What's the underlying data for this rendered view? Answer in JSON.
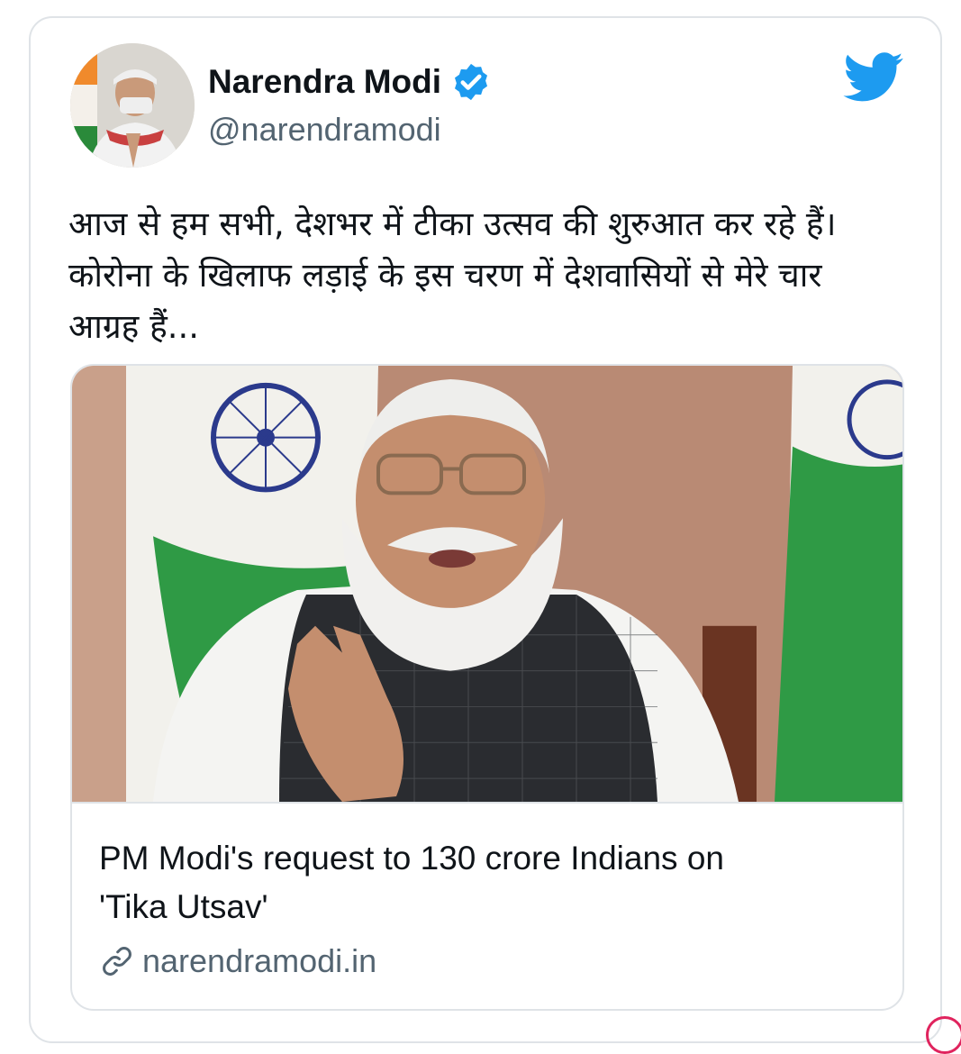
{
  "tweet": {
    "author": {
      "name": "Narendra Modi",
      "handle": "@narendramodi",
      "verified": true
    },
    "text_lines": [
      "आज से हम सभी, देशभर में टीका उत्सव की शुरुआत कर रहे हैं।",
      "कोरोना के खिलाफ लड़ाई के इस चरण में देशवासियों से मेरे चार",
      "आग्रह हैं..."
    ],
    "link_card": {
      "title_lines": [
        "PM Modi's request to 130 crore Indians on",
        "'Tika Utsav'"
      ],
      "domain": "narendramodi.in"
    }
  },
  "icons": {
    "brand": "twitter-bird-icon",
    "verified": "verified-badge-icon",
    "link": "link-icon"
  },
  "colors": {
    "twitter_blue": "#1d9bf0",
    "text_primary": "#0f1419",
    "text_secondary": "#536471",
    "border": "#dfe3e7"
  }
}
